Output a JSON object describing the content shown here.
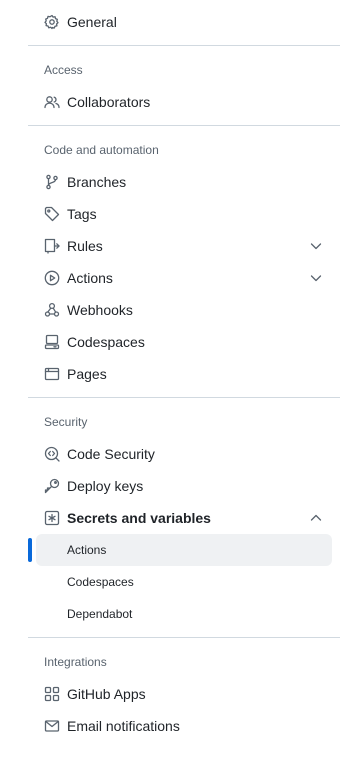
{
  "nav": {
    "general": "General",
    "access_heading": "Access",
    "collaborators": "Collaborators",
    "code_heading": "Code and automation",
    "branches": "Branches",
    "tags": "Tags",
    "rules": "Rules",
    "actions": "Actions",
    "webhooks": "Webhooks",
    "codespaces": "Codespaces",
    "pages": "Pages",
    "security_heading": "Security",
    "code_security": "Code Security",
    "deploy_keys": "Deploy keys",
    "secrets": "Secrets and variables",
    "secrets_sub": [
      "Actions",
      "Codespaces",
      "Dependabot"
    ],
    "integrations_heading": "Integrations",
    "github_apps": "GitHub Apps",
    "email_notifications": "Email notifications"
  },
  "colors": {
    "accent": "#0969da",
    "active_bg": "#eff1f3",
    "divider": "#d1d9e0",
    "muted_text": "#59636e"
  }
}
